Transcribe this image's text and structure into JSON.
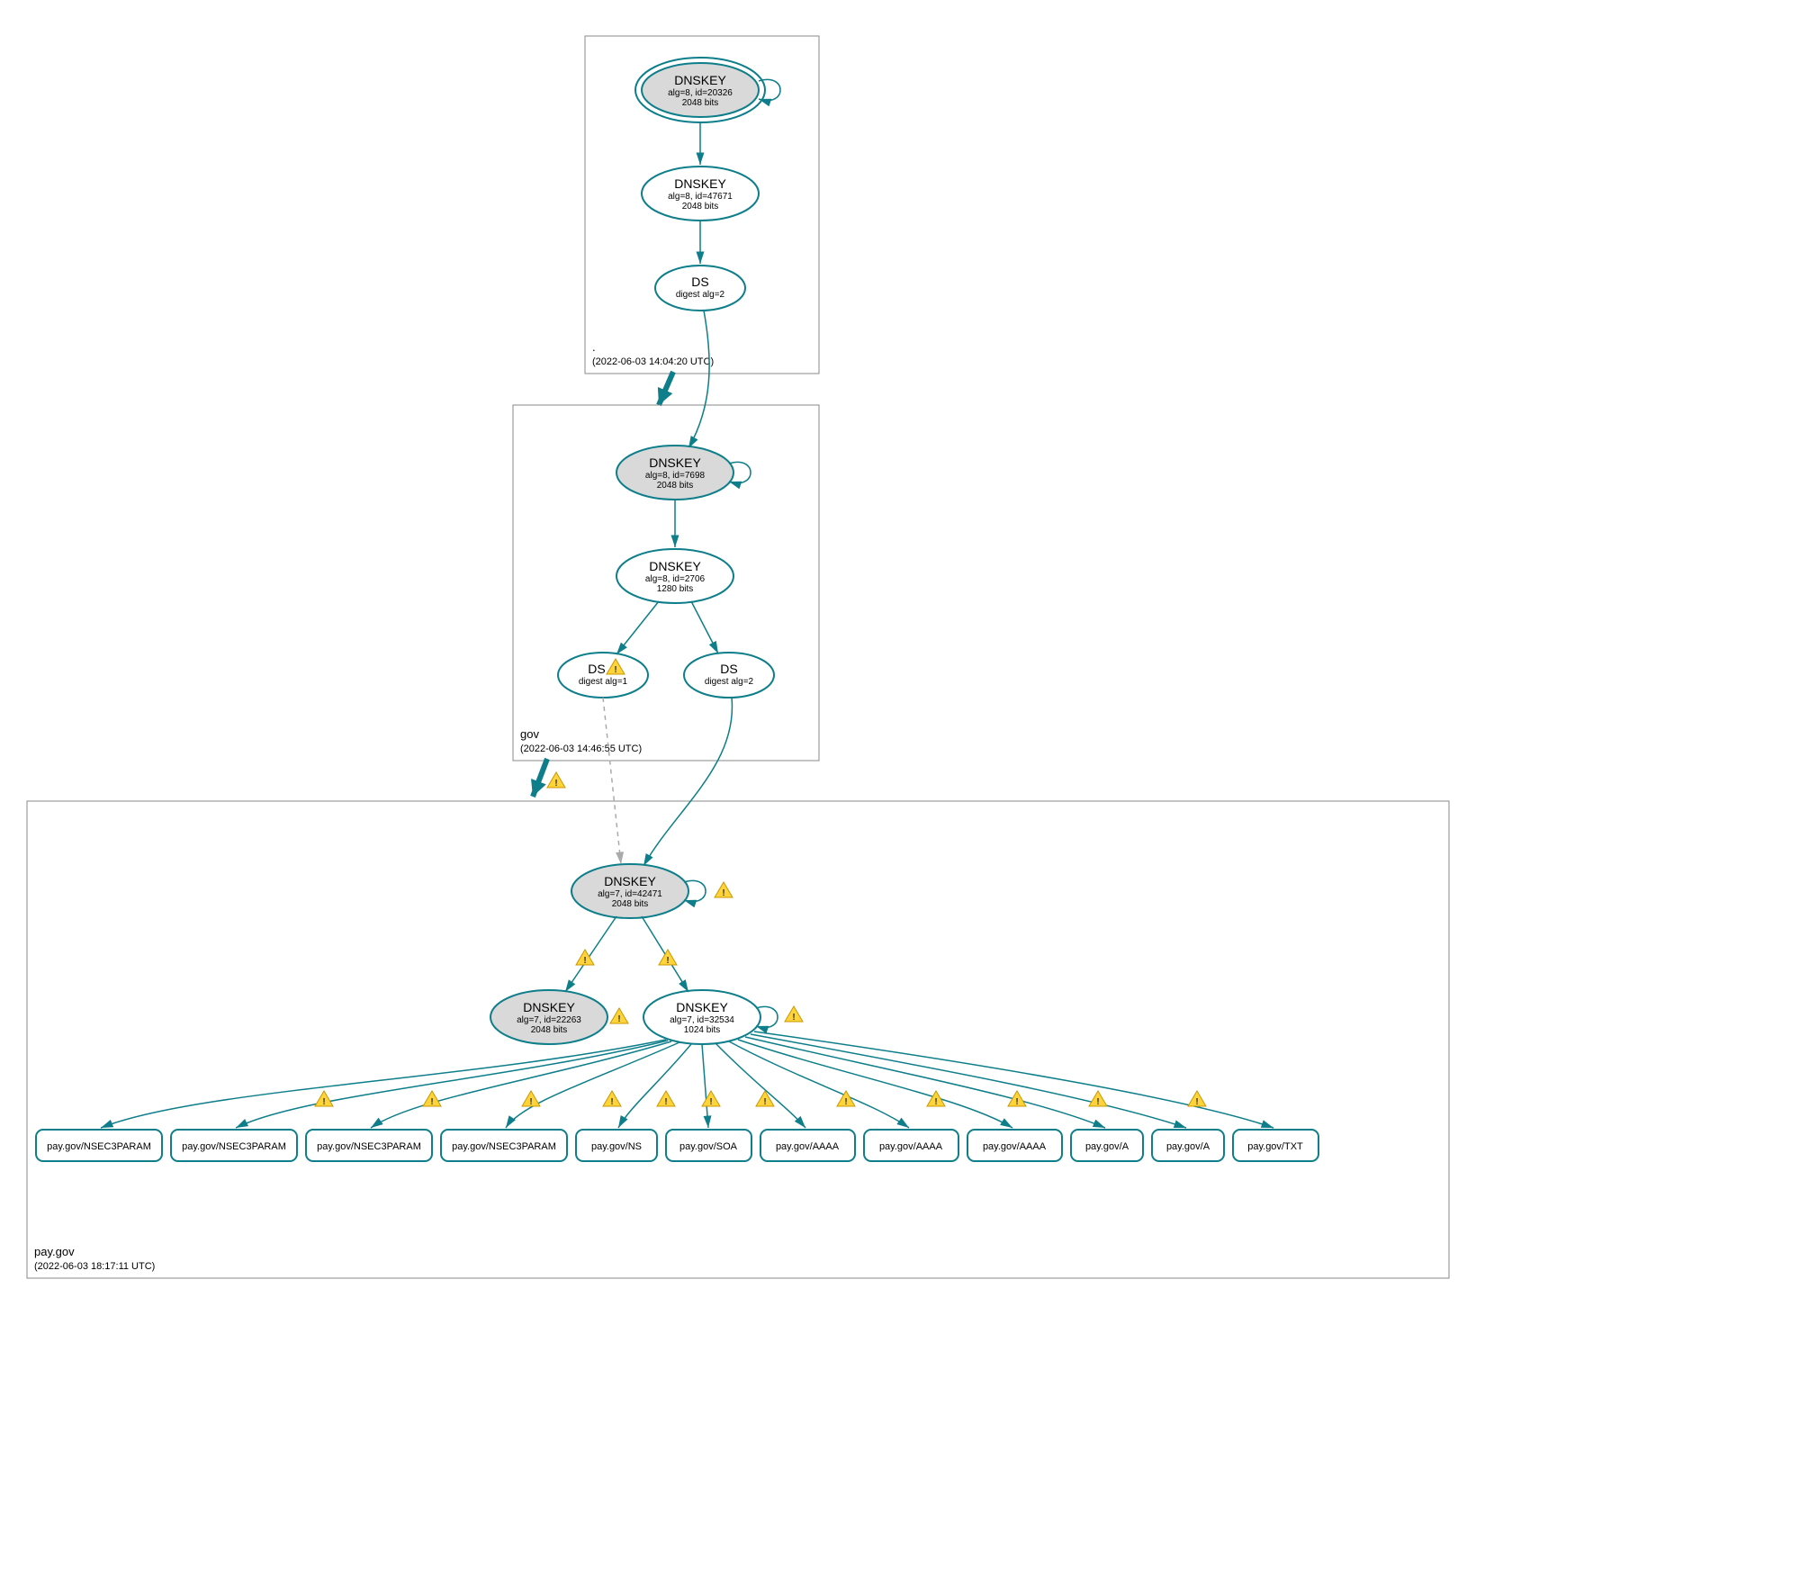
{
  "zones": {
    "root": {
      "label": ".",
      "timestamp": "(2022-06-03 14:04:20 UTC)"
    },
    "gov": {
      "label": "gov",
      "timestamp": "(2022-06-03 14:46:55 UTC)"
    },
    "paygov": {
      "label": "pay.gov",
      "timestamp": "(2022-06-03 18:17:11 UTC)"
    }
  },
  "nodes": {
    "root_ksk": {
      "title": "DNSKEY",
      "sub1": "alg=8, id=20326",
      "sub2": "2048 bits"
    },
    "root_zsk": {
      "title": "DNSKEY",
      "sub1": "alg=8, id=47671",
      "sub2": "2048 bits"
    },
    "root_ds": {
      "title": "DS",
      "sub1": "digest alg=2"
    },
    "gov_ksk": {
      "title": "DNSKEY",
      "sub1": "alg=8, id=7698",
      "sub2": "2048 bits"
    },
    "gov_zsk": {
      "title": "DNSKEY",
      "sub1": "alg=8, id=2706",
      "sub2": "1280 bits"
    },
    "gov_ds1": {
      "title": "DS",
      "sub1": "digest alg=1"
    },
    "gov_ds2": {
      "title": "DS",
      "sub1": "digest alg=2"
    },
    "pay_ksk": {
      "title": "DNSKEY",
      "sub1": "alg=7, id=42471",
      "sub2": "2048 bits"
    },
    "pay_k2": {
      "title": "DNSKEY",
      "sub1": "alg=7, id=22263",
      "sub2": "2048 bits"
    },
    "pay_zsk": {
      "title": "DNSKEY",
      "sub1": "alg=7, id=32534",
      "sub2": "1024 bits"
    }
  },
  "records": {
    "r0": "pay.gov/NSEC3PARAM",
    "r1": "pay.gov/NSEC3PARAM",
    "r2": "pay.gov/NSEC3PARAM",
    "r3": "pay.gov/NSEC3PARAM",
    "r4": "pay.gov/NS",
    "r5": "pay.gov/SOA",
    "r6": "pay.gov/AAAA",
    "r7": "pay.gov/AAAA",
    "r8": "pay.gov/AAAA",
    "r9": "pay.gov/A",
    "r10": "pay.gov/A",
    "r11": "pay.gov/TXT"
  }
}
